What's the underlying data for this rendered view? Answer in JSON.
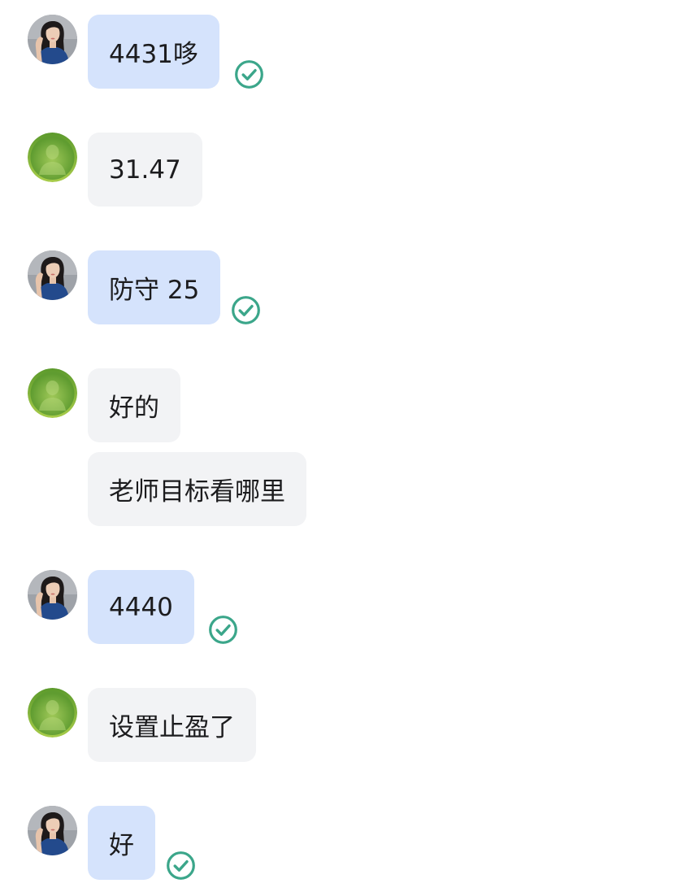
{
  "theme": {
    "sent_bubble_color": "#d5e3fc",
    "received_bubble_color": "#f2f3f5",
    "read_check_color": "#3ba68a",
    "received_avatar_color": "#7cb342"
  },
  "icons": {
    "sender_avatar": "woman-profile-photo-avatar",
    "receiver_avatar": "green-default-user-avatar",
    "read_receipt": "check-circle-icon"
  },
  "messages": [
    {
      "text": "4431哆",
      "direction": "sent",
      "read": true
    },
    {
      "text": "31.47",
      "direction": "received"
    },
    {
      "text": "防守 25",
      "direction": "sent",
      "read": true
    },
    {
      "text": "好的",
      "direction": "received"
    },
    {
      "text": "老师目标看哪里",
      "direction": "received"
    },
    {
      "text": "4440",
      "direction": "sent",
      "read": true
    },
    {
      "text": "设置止盈了",
      "direction": "received"
    },
    {
      "text": "好",
      "direction": "sent",
      "read": true
    }
  ]
}
